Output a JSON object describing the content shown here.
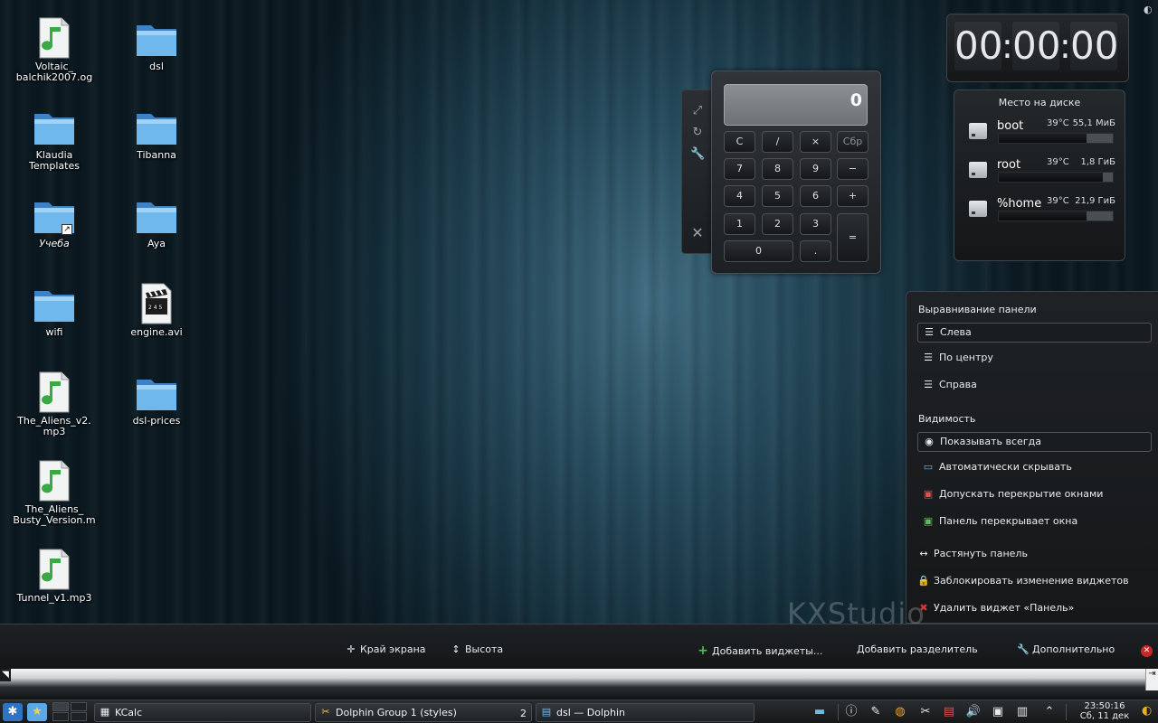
{
  "desktop": {
    "icons": [
      {
        "label": "Voltaic_ balchik2007.og",
        "type": "audio"
      },
      {
        "label": "dsl",
        "type": "folder"
      },
      {
        "label": "Klaudia Templates",
        "type": "folder"
      },
      {
        "label": "Tibanna",
        "type": "folder"
      },
      {
        "label": "Учеба",
        "type": "folder-link"
      },
      {
        "label": "Aya",
        "type": "folder"
      },
      {
        "label": "wifi",
        "type": "folder"
      },
      {
        "label": "engine.avi",
        "type": "video"
      },
      {
        "label": "The_Aliens_v2. mp3",
        "type": "audio"
      },
      {
        "label": "dsl-prices",
        "type": "folder"
      },
      {
        "label": "The_Aliens_ Busty_Version.m",
        "type": "audio"
      },
      {
        "label": "Tunnel_v1.mp3",
        "type": "audio"
      }
    ],
    "watermark": "KXStudio"
  },
  "calculator": {
    "display": "0",
    "tools": [
      "resize-icon",
      "rotate-icon",
      "wrench-icon",
      "close-icon"
    ],
    "buttons": {
      "clear": "C",
      "divide": "/",
      "multiply": "×",
      "reset": "Сбр",
      "n7": "7",
      "n8": "8",
      "n9": "9",
      "minus": "−",
      "n4": "4",
      "n5": "5",
      "n6": "6",
      "plus": "+",
      "n1": "1",
      "n2": "2",
      "n3": "3",
      "equals": "=",
      "n0": "0",
      "dot": "."
    }
  },
  "clock_widget": {
    "hours": "00",
    "minutes": "00",
    "seconds": "00",
    "separator": ":"
  },
  "disk_widget": {
    "title": "Место на диске",
    "disks": [
      {
        "name": "boot",
        "temp": "39°C",
        "free": "55,1 МиБ",
        "used_fraction": 0.77
      },
      {
        "name": "root",
        "temp": "39°C",
        "free": "1,8 ГиБ",
        "used_fraction": 0.91
      },
      {
        "name": "%home",
        "temp": "39°C",
        "free": "21,9 ГиБ",
        "used_fraction": 0.77
      }
    ]
  },
  "panel_menu": {
    "alignment_header": "Выравнивание панели",
    "alignment_options": [
      {
        "label": "Слева",
        "selected": true
      },
      {
        "label": "По центру",
        "selected": false
      },
      {
        "label": "Справа",
        "selected": false
      }
    ],
    "visibility_header": "Видимость",
    "visibility_options": [
      {
        "label": "Показывать всегда",
        "selected": true
      },
      {
        "label": "Автоматически скрывать",
        "selected": false
      },
      {
        "label": "Допускать перекрытие окнами",
        "selected": false
      },
      {
        "label": "Панель перекрывает окна",
        "selected": false
      }
    ],
    "actions": [
      {
        "label": "Растянуть панель",
        "icon": "stretch-arrows-icon"
      },
      {
        "label": "Заблокировать изменение виджетов",
        "icon": "lock-icon"
      },
      {
        "label": "Удалить виджет «Панель»",
        "icon": "delete-x-icon"
      }
    ]
  },
  "panel_controller": {
    "screen_edge": "Край экрана",
    "height": "Высота",
    "add_widgets": "Добавить виджеты...",
    "add_spacer": "Добавить разделитель",
    "more": "Дополнительно"
  },
  "taskbar": {
    "tasks": [
      {
        "label": "KCalc",
        "icon": "calculator-icon",
        "count": ""
      },
      {
        "label": "Dolphin Group 1 (styles)",
        "icon": "dolphin-icon",
        "count": "2"
      },
      {
        "label": "dsl — Dolphin",
        "icon": "folder-window-icon",
        "count": ""
      }
    ],
    "clock_time": "23:50:16",
    "clock_date": "Сб, 11 дек"
  },
  "colors": {
    "accent_red": "#c62828",
    "folder_blue": "#5aa9e6",
    "moon_orange": "#f2b01e"
  }
}
